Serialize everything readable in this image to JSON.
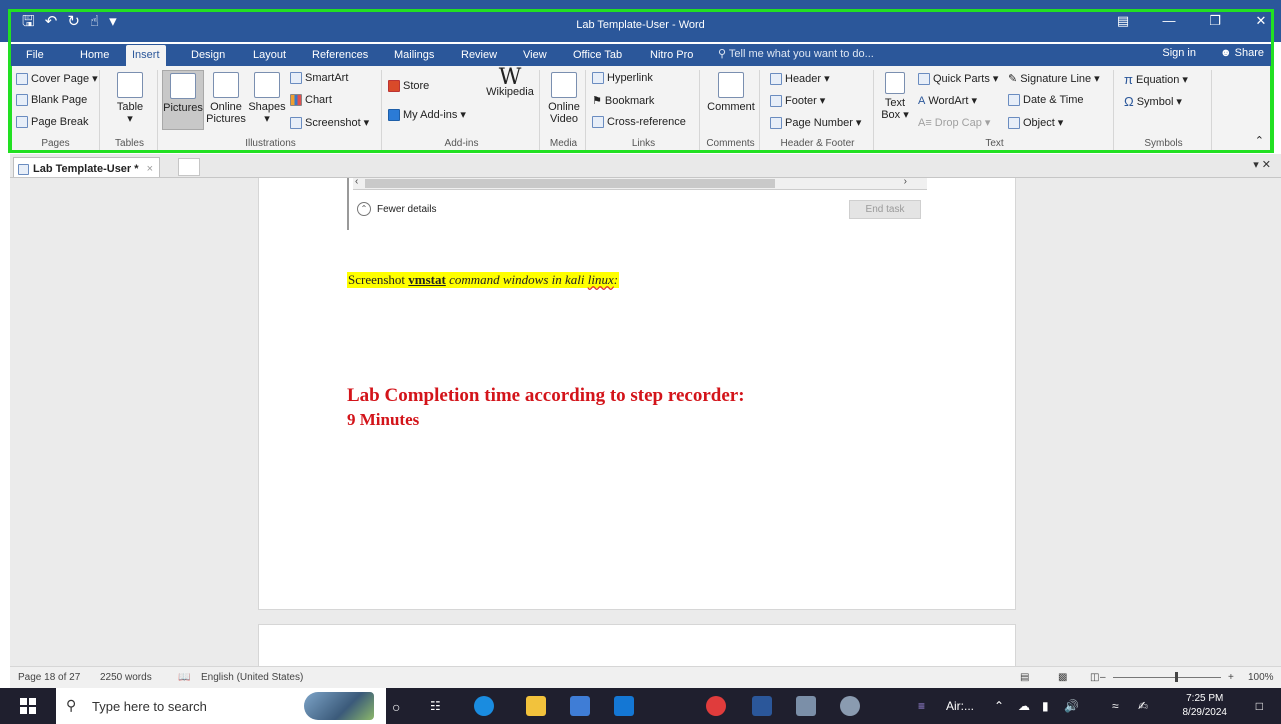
{
  "window": {
    "title": "Lab Template-User - Word",
    "qat": [
      "save-icon",
      "undo-icon",
      "redo-icon",
      "touch-mode-icon",
      "customize-icon"
    ],
    "controls": [
      "ribbon-display-icon",
      "minimize-icon",
      "restore-icon",
      "close-icon"
    ]
  },
  "menu": {
    "tabs": [
      "File",
      "Home",
      "Insert",
      "Design",
      "Layout",
      "References",
      "Mailings",
      "Review",
      "View",
      "Office Tab",
      "Nitro Pro"
    ],
    "active": "Insert",
    "tell_me": "Tell me what you want to do...",
    "sign_in": "Sign in",
    "share": "Share"
  },
  "ribbon": {
    "pages": {
      "label": "Pages",
      "cover_page": "Cover Page",
      "blank_page": "Blank Page",
      "page_break": "Page Break"
    },
    "tables": {
      "label": "Tables",
      "table": "Table"
    },
    "illustrations": {
      "label": "Illustrations",
      "pictures": "Pictures",
      "online_pictures_1": "Online",
      "online_pictures_2": "Pictures",
      "shapes": "Shapes",
      "smartart": "SmartArt",
      "chart": "Chart",
      "screenshot": "Screenshot"
    },
    "addins": {
      "label": "Add-ins",
      "store": "Store",
      "my_addins": "My Add-ins",
      "wikipedia": "Wikipedia",
      "wiki_glyph": "W"
    },
    "media": {
      "label": "Media",
      "online_video_1": "Online",
      "online_video_2": "Video"
    },
    "links": {
      "label": "Links",
      "hyperlink": "Hyperlink",
      "bookmark": "Bookmark",
      "cross_reference": "Cross-reference"
    },
    "comments": {
      "label": "Comments",
      "comment": "Comment"
    },
    "header_footer": {
      "label": "Header & Footer",
      "header": "Header",
      "footer": "Footer",
      "page_number": "Page Number"
    },
    "text": {
      "label": "Text",
      "text_box_1": "Text",
      "text_box_2": "Box",
      "quick_parts": "Quick Parts",
      "wordart": "WordArt",
      "drop_cap": "Drop Cap",
      "signature_line": "Signature Line",
      "date_time": "Date & Time",
      "object": "Object"
    },
    "symbols": {
      "label": "Symbols",
      "equation": "Equation",
      "symbol": "Symbol"
    }
  },
  "doc_tabs": {
    "active": "Lab Template-User *"
  },
  "document": {
    "embedded": {
      "fewer_details": "Fewer details",
      "end_task": "End task"
    },
    "screenshot_line": {
      "part1": "Screenshot ",
      "part2": "vmstat",
      "part3": " command windows in kali ",
      "part4": "linux",
      "part5": ":"
    },
    "lab_completion": "Lab Completion time according to step recorder:",
    "minutes": "9 Minutes"
  },
  "status": {
    "page": "Page 18 of 27",
    "words": "2250 words",
    "language": "English (United States)",
    "zoom": "100%",
    "zoom_level": 1.0
  },
  "taskbar": {
    "search_placeholder": "Type here to search",
    "air_label": "Air:...",
    "time": "7:25 PM",
    "date": "8/29/2024"
  },
  "colors": {
    "word_blue": "#2b579a",
    "highlight": "#ffff00",
    "heading_red": "#d3141a",
    "outline_green": "#22e022"
  }
}
